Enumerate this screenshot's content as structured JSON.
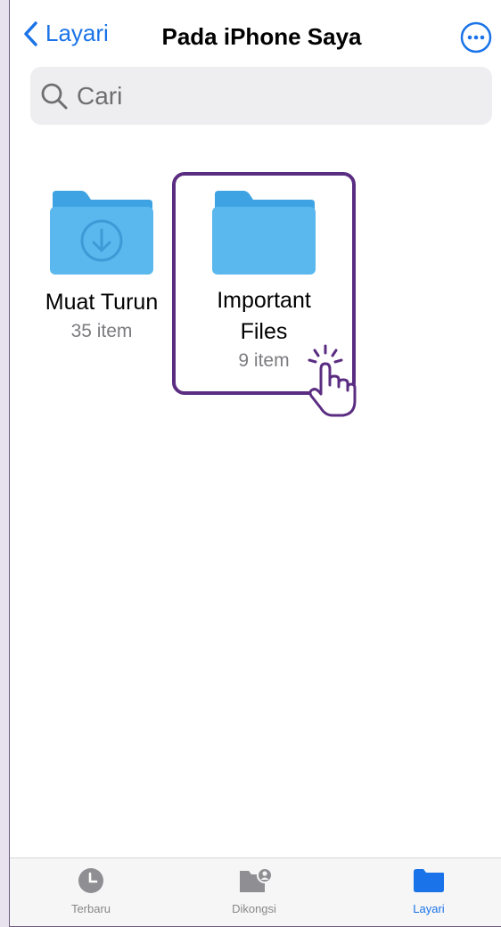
{
  "nav": {
    "back_label": "Layari",
    "title": "Pada iPhone Saya",
    "more_icon": "ellipsis-circle-icon"
  },
  "search": {
    "placeholder": "Cari",
    "icon": "magnifying-glass-icon"
  },
  "folders": [
    {
      "name": "Muat Turun",
      "count": "35 item",
      "icon": "download-folder-icon"
    },
    {
      "name_line1": "Important",
      "name_line2": "Files",
      "count": "9 item",
      "icon": "folder-icon",
      "highlighted": true
    }
  ],
  "tabs": [
    {
      "label": "Terbaru",
      "icon": "clock-icon",
      "active": false
    },
    {
      "label": "Dikongsi",
      "icon": "shared-folder-icon",
      "active": false
    },
    {
      "label": "Layari",
      "icon": "folder-icon",
      "active": true
    }
  ],
  "colors": {
    "accent": "#1a73e8",
    "folder": "#5ab8ee",
    "folder_tab": "#3da3e2",
    "highlight": "#5b2d82"
  }
}
